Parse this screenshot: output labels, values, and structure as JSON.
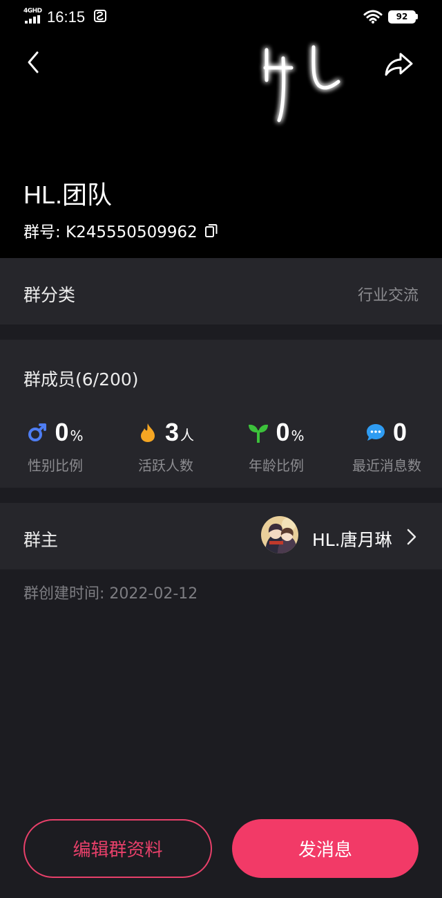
{
  "status_bar": {
    "network": "4GHD",
    "time": "16:15",
    "battery": "92"
  },
  "header": {
    "logo_text": "HL",
    "group_name": "HL.团队",
    "group_id_label": "群号: K245550509962"
  },
  "category": {
    "label": "群分类",
    "value": "行业交流"
  },
  "members": {
    "title": "群成员(6/200)",
    "stats": [
      {
        "icon": "male-gender-icon",
        "value": "0",
        "unit": "%",
        "caption": "性别比例",
        "color": "#4e7df2"
      },
      {
        "icon": "flame-icon",
        "value": "3",
        "unit": "人",
        "caption": "活跃人数",
        "color": "#f5a623"
      },
      {
        "icon": "sprout-icon",
        "value": "0",
        "unit": "%",
        "caption": "年龄比例",
        "color": "#3cc13b"
      },
      {
        "icon": "chat-bubble-icon",
        "value": "0",
        "unit": "",
        "caption": "最近消息数",
        "color": "#2f9cf2"
      }
    ]
  },
  "owner": {
    "label": "群主",
    "name": "HL.唐月琳"
  },
  "created": "群创建时间: 2022-02-12",
  "actions": {
    "edit": "编辑群资料",
    "send": "发消息"
  },
  "colors": {
    "accent": "#f23a67",
    "background": "#1c1c21",
    "card": "#26262b"
  }
}
